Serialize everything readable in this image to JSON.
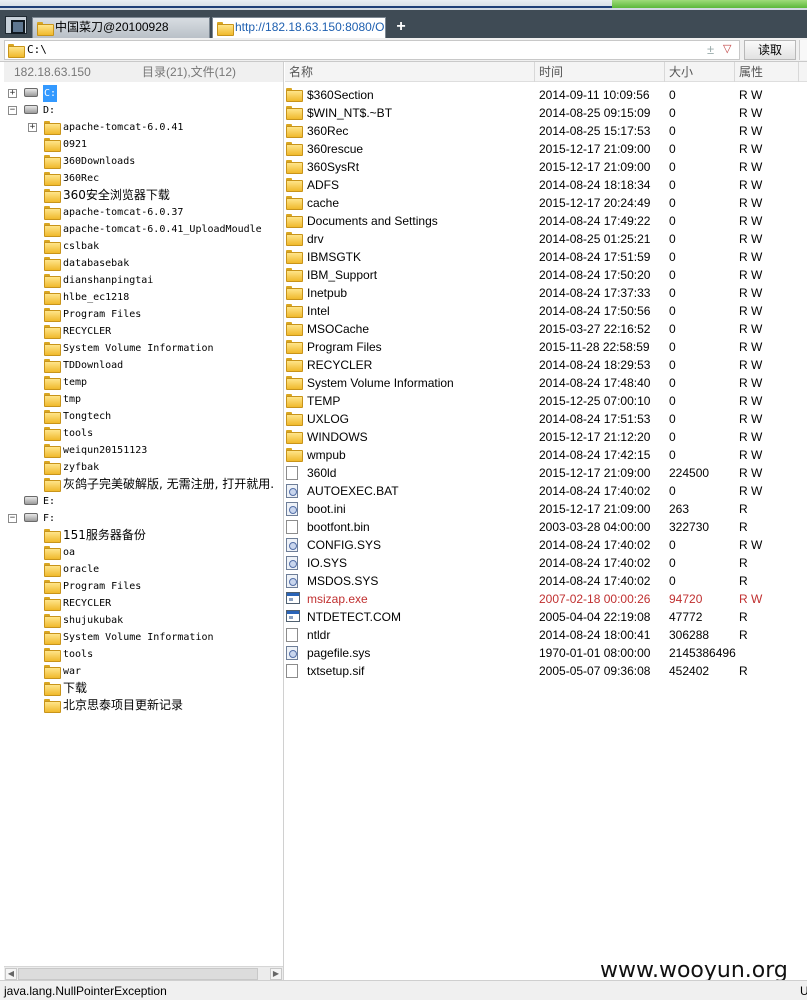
{
  "tabs": [
    {
      "label": "中国菜刀@20100928",
      "active": false
    },
    {
      "label": "http://182.18.63.150:8080/O...",
      "active": true
    }
  ],
  "new_tab_label": "+",
  "address": {
    "path": "C:\\",
    "plus": "±",
    "drop": "▽"
  },
  "read_button": "读取",
  "left_header": {
    "ip": "182.18.63.150",
    "counts": "目录(21),文件(12)"
  },
  "tree": [
    {
      "label": "C:",
      "depth": 0,
      "type": "drive",
      "expander": "+",
      "selected": true
    },
    {
      "label": "D:",
      "depth": 0,
      "type": "drive",
      "expander": "−"
    },
    {
      "label": "apache-tomcat-6.0.41",
      "depth": 1,
      "type": "folder",
      "expander": "+"
    },
    {
      "label": "0921",
      "depth": 1,
      "type": "folder"
    },
    {
      "label": "360Downloads",
      "depth": 1,
      "type": "folder"
    },
    {
      "label": "360Rec",
      "depth": 1,
      "type": "folder"
    },
    {
      "label": "360安全浏览器下载",
      "depth": 1,
      "type": "folder",
      "cn": true
    },
    {
      "label": "apache-tomcat-6.0.37",
      "depth": 1,
      "type": "folder"
    },
    {
      "label": "apache-tomcat-6.0.41_UploadMoudle",
      "depth": 1,
      "type": "folder"
    },
    {
      "label": "cslbak",
      "depth": 1,
      "type": "folder"
    },
    {
      "label": "databasebak",
      "depth": 1,
      "type": "folder"
    },
    {
      "label": "dianshanpingtai",
      "depth": 1,
      "type": "folder"
    },
    {
      "label": "hlbe_ec1218",
      "depth": 1,
      "type": "folder"
    },
    {
      "label": "Program Files",
      "depth": 1,
      "type": "folder"
    },
    {
      "label": "RECYCLER",
      "depth": 1,
      "type": "folder"
    },
    {
      "label": "System Volume Information",
      "depth": 1,
      "type": "folder"
    },
    {
      "label": "TDDownload",
      "depth": 1,
      "type": "folder"
    },
    {
      "label": "temp",
      "depth": 1,
      "type": "folder"
    },
    {
      "label": "tmp",
      "depth": 1,
      "type": "folder"
    },
    {
      "label": "Tongtech",
      "depth": 1,
      "type": "folder"
    },
    {
      "label": "tools",
      "depth": 1,
      "type": "folder"
    },
    {
      "label": "weiqun20151123",
      "depth": 1,
      "type": "folder"
    },
    {
      "label": "zyfbak",
      "depth": 1,
      "type": "folder"
    },
    {
      "label": "灰鸽子完美破解版, 无需注册, 打开就用.",
      "depth": 1,
      "type": "folder",
      "cn": true
    },
    {
      "label": "E:",
      "depth": 0,
      "type": "drive"
    },
    {
      "label": "F:",
      "depth": 0,
      "type": "drive",
      "expander": "−"
    },
    {
      "label": "151服务器备份",
      "depth": 1,
      "type": "folder",
      "cn": true
    },
    {
      "label": "oa",
      "depth": 1,
      "type": "folder"
    },
    {
      "label": "oracle",
      "depth": 1,
      "type": "folder"
    },
    {
      "label": "Program Files",
      "depth": 1,
      "type": "folder"
    },
    {
      "label": "RECYCLER",
      "depth": 1,
      "type": "folder"
    },
    {
      "label": "shujukubak",
      "depth": 1,
      "type": "folder"
    },
    {
      "label": "System Volume Information",
      "depth": 1,
      "type": "folder"
    },
    {
      "label": "tools",
      "depth": 1,
      "type": "folder"
    },
    {
      "label": "war",
      "depth": 1,
      "type": "folder"
    },
    {
      "label": "下载",
      "depth": 1,
      "type": "folder",
      "cn": true
    },
    {
      "label": "北京思泰项目更新记录",
      "depth": 1,
      "type": "folder",
      "cn": true
    }
  ],
  "file_columns": {
    "name": "名称",
    "time": "时间",
    "size": "大小",
    "attr": "属性"
  },
  "files": [
    {
      "name": "$360Section",
      "time": "2014-09-11 10:09:56",
      "size": "0",
      "attr": "R W",
      "icon": "folder"
    },
    {
      "name": "$WIN_NT$.~BT",
      "time": "2014-08-25 09:15:09",
      "size": "0",
      "attr": "R W",
      "icon": "folder"
    },
    {
      "name": "360Rec",
      "time": "2014-08-25 15:17:53",
      "size": "0",
      "attr": "R W",
      "icon": "folder"
    },
    {
      "name": "360rescue",
      "time": "2015-12-17 21:09:00",
      "size": "0",
      "attr": "R W",
      "icon": "folder"
    },
    {
      "name": "360SysRt",
      "time": "2015-12-17 21:09:00",
      "size": "0",
      "attr": "R W",
      "icon": "folder"
    },
    {
      "name": "ADFS",
      "time": "2014-08-24 18:18:34",
      "size": "0",
      "attr": "R W",
      "icon": "folder"
    },
    {
      "name": "cache",
      "time": "2015-12-17 20:24:49",
      "size": "0",
      "attr": "R W",
      "icon": "folder"
    },
    {
      "name": "Documents and Settings",
      "time": "2014-08-24 17:49:22",
      "size": "0",
      "attr": "R W",
      "icon": "folder"
    },
    {
      "name": "drv",
      "time": "2014-08-25 01:25:21",
      "size": "0",
      "attr": "R W",
      "icon": "folder"
    },
    {
      "name": "IBMSGTK",
      "time": "2014-08-24 17:51:59",
      "size": "0",
      "attr": "R W",
      "icon": "folder"
    },
    {
      "name": "IBM_Support",
      "time": "2014-08-24 17:50:20",
      "size": "0",
      "attr": "R W",
      "icon": "folder"
    },
    {
      "name": "Inetpub",
      "time": "2014-08-24 17:37:33",
      "size": "0",
      "attr": "R W",
      "icon": "folder"
    },
    {
      "name": "Intel",
      "time": "2014-08-24 17:50:56",
      "size": "0",
      "attr": "R W",
      "icon": "folder"
    },
    {
      "name": "MSOCache",
      "time": "2015-03-27 22:16:52",
      "size": "0",
      "attr": "R W",
      "icon": "folder"
    },
    {
      "name": "Program Files",
      "time": "2015-11-28 22:58:59",
      "size": "0",
      "attr": "R W",
      "icon": "folder"
    },
    {
      "name": "RECYCLER",
      "time": "2014-08-24 18:29:53",
      "size": "0",
      "attr": "R W",
      "icon": "folder"
    },
    {
      "name": "System Volume Information",
      "time": "2014-08-24 17:48:40",
      "size": "0",
      "attr": "R W",
      "icon": "folder"
    },
    {
      "name": "TEMP",
      "time": "2015-12-25 07:00:10",
      "size": "0",
      "attr": "R W",
      "icon": "folder"
    },
    {
      "name": "UXLOG",
      "time": "2014-08-24 17:51:53",
      "size": "0",
      "attr": "R W",
      "icon": "folder"
    },
    {
      "name": "WINDOWS",
      "time": "2015-12-17 21:12:20",
      "size": "0",
      "attr": "R W",
      "icon": "folder"
    },
    {
      "name": "wmpub",
      "time": "2014-08-24 17:42:15",
      "size": "0",
      "attr": "R W",
      "icon": "folder"
    },
    {
      "name": "360ld",
      "time": "2015-12-17 21:09:00",
      "size": "224500",
      "attr": "R W",
      "icon": "doc"
    },
    {
      "name": "AUTOEXEC.BAT",
      "time": "2014-08-24 17:40:02",
      "size": "0",
      "attr": "R W",
      "icon": "sys"
    },
    {
      "name": "boot.ini",
      "time": "2015-12-17 21:09:00",
      "size": "263",
      "attr": "R",
      "icon": "sys"
    },
    {
      "name": "bootfont.bin",
      "time": "2003-03-28 04:00:00",
      "size": "322730",
      "attr": "R",
      "icon": "doc"
    },
    {
      "name": "CONFIG.SYS",
      "time": "2014-08-24 17:40:02",
      "size": "0",
      "attr": "R W",
      "icon": "sys"
    },
    {
      "name": "IO.SYS",
      "time": "2014-08-24 17:40:02",
      "size": "0",
      "attr": "R",
      "icon": "sys"
    },
    {
      "name": "MSDOS.SYS",
      "time": "2014-08-24 17:40:02",
      "size": "0",
      "attr": "R",
      "icon": "sys"
    },
    {
      "name": "msizap.exe",
      "time": "2007-02-18 00:00:26",
      "size": "94720",
      "attr": "R W",
      "icon": "exe",
      "highlight": true
    },
    {
      "name": "NTDETECT.COM",
      "time": "2005-04-04 22:19:08",
      "size": "47772",
      "attr": "R",
      "icon": "exe"
    },
    {
      "name": "ntldr",
      "time": "2014-08-24 18:00:41",
      "size": "306288",
      "attr": "R",
      "icon": "doc"
    },
    {
      "name": "pagefile.sys",
      "time": "1970-01-01 08:00:00",
      "size": "2145386496",
      "attr": "",
      "icon": "sys"
    },
    {
      "name": "txtsetup.sif",
      "time": "2005-05-07 09:36:08",
      "size": "452402",
      "attr": "R",
      "icon": "doc"
    }
  ],
  "watermark": "www.wooyun.org",
  "status": {
    "message": "java.lang.NullPointerException",
    "right": "U"
  },
  "colors": {
    "selection": "#3399ff",
    "highlight_row": "#c03030",
    "tab_bar": "#3f4b55"
  }
}
